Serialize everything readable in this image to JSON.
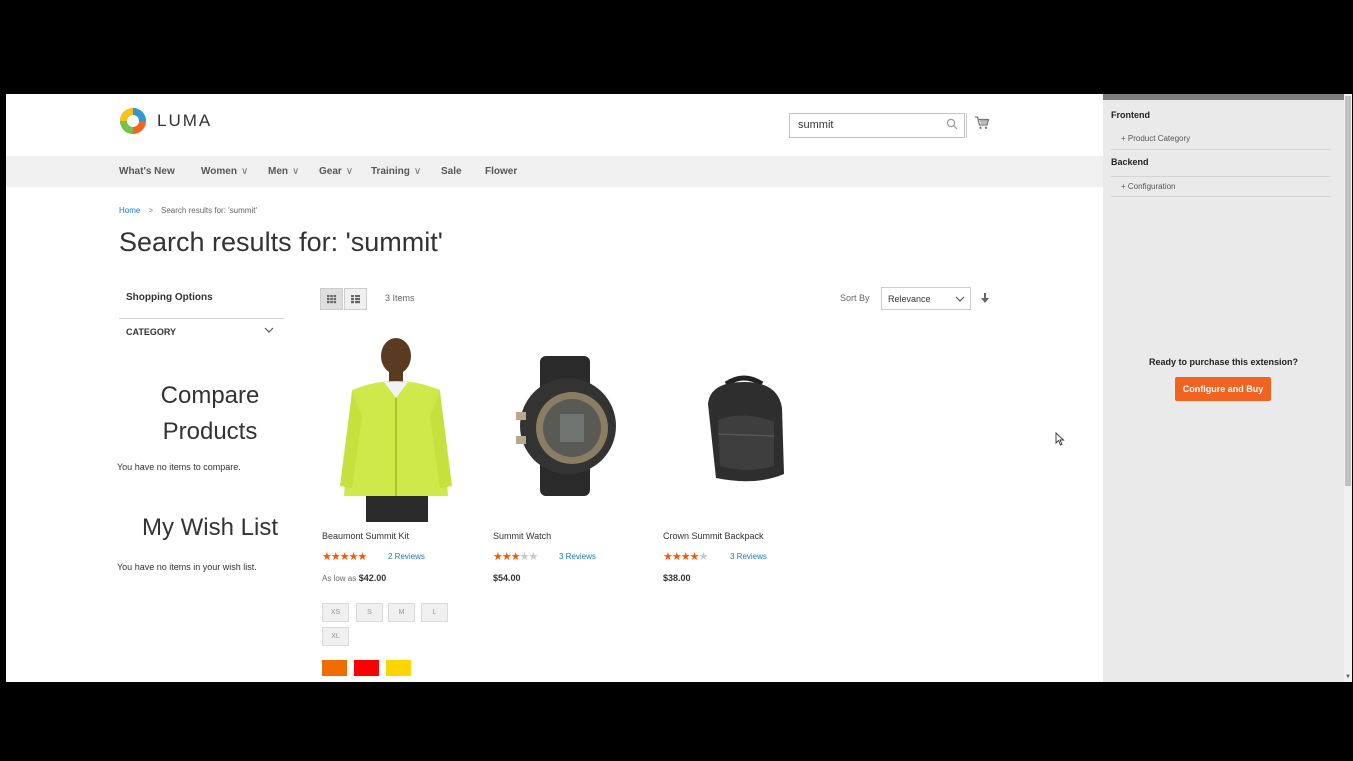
{
  "header": {
    "logo_text": "LUMA",
    "search_value": "summit",
    "icons": [
      "luma-logo-icon",
      "search-icon",
      "cart-icon"
    ]
  },
  "nav": {
    "items": [
      "What's New",
      "Women",
      "Men",
      "Gear",
      "Training",
      "Sale",
      "Flower"
    ],
    "chevron": "∨"
  },
  "breadcrumb": {
    "home": "Home",
    "separator": ">",
    "current": "Search results for: 'summit'"
  },
  "page_title": "Search results for: 'summit'",
  "sidebar": {
    "shopping_options": "Shopping Options",
    "category": "CATEGORY",
    "compare_title": "Compare Products",
    "compare_text": "You have no items to compare.",
    "wish_title": "My Wish List",
    "wish_text": "You have no items in your wish list."
  },
  "toolbar": {
    "amount": "3 Items",
    "sort_label": "Sort By",
    "sort_value": "Relevance"
  },
  "products": [
    {
      "name": "Beaumont Summit Kit",
      "rating_stars": 4.5,
      "reviews": "2 Reviews",
      "price_prefix": "As low as",
      "price": "$42.00",
      "sizes": [
        "XS",
        "S",
        "M",
        "L",
        "XL"
      ],
      "colors": [
        "#ef6c00",
        "#ff0000",
        "#ffd500"
      ]
    },
    {
      "name": "Summit Watch",
      "rating_stars": 2.5,
      "reviews": "3 Reviews",
      "price": "$54.00"
    },
    {
      "name": "Crown Summit Backpack",
      "rating_stars": 3.5,
      "reviews": "3 Reviews",
      "price": "$38.00"
    }
  ],
  "panel": {
    "frontend": "Frontend",
    "product_category": "Product Category",
    "backend": "Backend",
    "configuration": "Configuration",
    "ready_text": "Ready to purchase this extension?",
    "button": "Configure and Buy",
    "accent": "#f26322"
  }
}
